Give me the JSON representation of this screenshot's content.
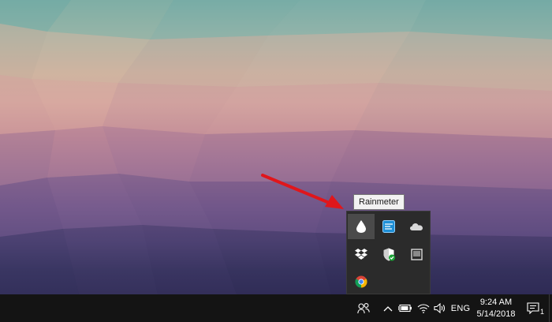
{
  "tooltip": {
    "text": "Rainmeter"
  },
  "tray_overflow": {
    "icons": [
      {
        "name": "rainmeter-icon",
        "hovered": true
      },
      {
        "name": "tool-app-icon",
        "hovered": false
      },
      {
        "name": "onedrive-icon",
        "hovered": false
      },
      {
        "name": "dropbox-icon",
        "hovered": false
      },
      {
        "name": "windows-defender-icon",
        "hovered": false
      },
      {
        "name": "tablet-icon",
        "hovered": false
      },
      {
        "name": "chrome-icon",
        "hovered": false
      }
    ]
  },
  "taskbar": {
    "icons": [
      "people-icon",
      "chevron-up-icon",
      "battery-icon",
      "wifi-icon",
      "volume-icon",
      "notification-center-icon"
    ],
    "language": "ENG",
    "time": "9:24 AM",
    "date": "5/14/2018",
    "notification_count": "1"
  },
  "colors": {
    "taskbar": "#141414",
    "tray_flyout": "#2b2b2b",
    "hover": "#4a4a4a",
    "arrow": "#e0161b"
  }
}
